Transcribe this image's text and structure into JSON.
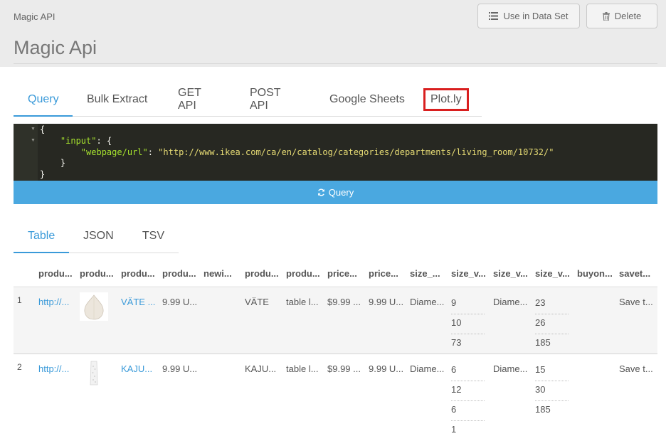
{
  "header": {
    "crumb": "Magic API",
    "title": "Magic Api",
    "use_label": "Use in Data Set",
    "delete_label": "Delete"
  },
  "top_tabs": [
    "Query",
    "Bulk Extract",
    "GET API",
    "POST API",
    "Google Sheets",
    "Plot.ly"
  ],
  "editor": {
    "l1": "{",
    "l2_key": "\"input\"",
    "l2_rest": ": {",
    "l3_key": "\"webpage/url\"",
    "l3_sep": ": ",
    "l3_val": "\"http://www.ikea.com/ca/en/catalog/categories/departments/living_room/10732/\"",
    "l4": "}",
    "l5": "}"
  },
  "query_label": "Query",
  "result_tabs": [
    "Table",
    "JSON",
    "TSV"
  ],
  "columns": [
    "produ...",
    "produ...",
    "produ...",
    "produ...",
    "newi...",
    "produ...",
    "produ...",
    "price...",
    "price...",
    "size_...",
    "size_v...",
    "size_v...",
    "size_v...",
    "buyon...",
    "savet..."
  ],
  "rows": [
    {
      "idx": "1",
      "url": "http://...",
      "name_link": "VÄTE ...",
      "price_text": "9.99 U...",
      "product": "VÄTE",
      "type": "table l...",
      "price": "$9.99 ...",
      "price2": "9.99 U...",
      "size_label": "Diame...",
      "size_values": [
        "9",
        "10",
        "73"
      ],
      "size_label2": "Diame...",
      "size_values2": [
        "23",
        "26",
        "185"
      ],
      "save": "Save t..."
    },
    {
      "idx": "2",
      "url": "http://...",
      "name_link": "KAJU...",
      "price_text": "9.99 U...",
      "product": "KAJU...",
      "type": "table l...",
      "price": "$9.99 ...",
      "price2": "9.99 U...",
      "size_label": "Diame...",
      "size_values": [
        "6",
        "12",
        "6",
        "1"
      ],
      "size_label2": "Diame...",
      "size_values2": [
        "15",
        "30",
        "185"
      ],
      "save": "Save t..."
    }
  ]
}
